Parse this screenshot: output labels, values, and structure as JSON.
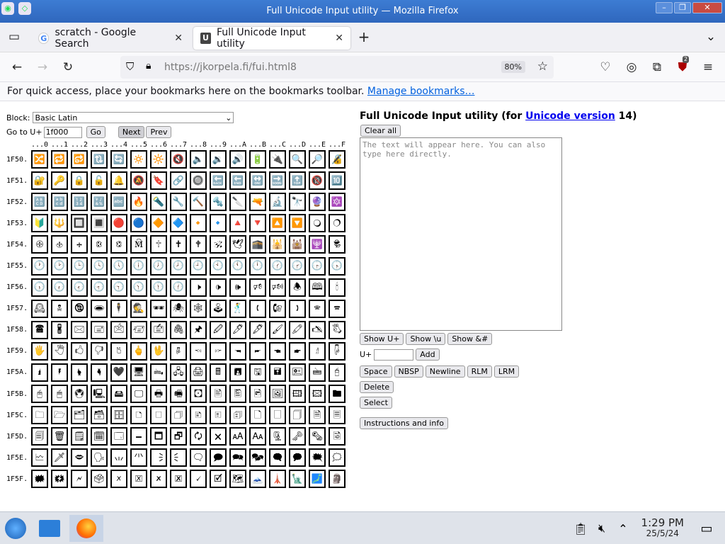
{
  "window": {
    "title": "Full Unicode Input utility — Mozilla Firefox"
  },
  "tabs": [
    {
      "label": "scratch - Google Search"
    },
    {
      "label": "Full Unicode Input utility"
    }
  ],
  "nav": {
    "url_host": "https://jkorpela.fi",
    "url_path": "/fui.html8",
    "zoom": "80%",
    "ext_badge": "2"
  },
  "bookmarks": {
    "text": "For quick access, place your bookmarks here on the bookmarks toolbar.",
    "link": "Manage bookmarks…"
  },
  "page": {
    "block_label": "Block:",
    "block_value": "Basic Latin",
    "goto_label": "Go to U+",
    "goto_value": "1f000",
    "go": "Go",
    "next": "Next",
    "prev": "Prev",
    "title_pre": "Full Unicode Input utility (for ",
    "title_link": "Unicode version",
    "title_post": " 14)",
    "clear_all": "Clear all",
    "placeholder": "The text will appear here. You can also type here directly.",
    "show_u": "Show U+",
    "show_bu": "Show \\u",
    "show_amp": "Show &#",
    "uplus": "U+",
    "add": "Add",
    "space": "Space",
    "nbsp": "NBSP",
    "newline": "Newline",
    "rlm": "RLM",
    "lrm": "LRM",
    "delete": "Delete",
    "select": "Select",
    "instructions": "Instructions and info"
  },
  "grid": {
    "col_headers": [
      "...0",
      "...1",
      "...2",
      "...3",
      "...4",
      "...5",
      "...6",
      "...7",
      "...8",
      "...9",
      "...A",
      "...B",
      "...C",
      "...D",
      "...E",
      "...F"
    ],
    "rows": [
      {
        "label": "1F50.",
        "cells": [
          "🔀",
          "🔁",
          "🔂",
          "🔃",
          "🔄",
          "🔅",
          "🔆",
          "🔇",
          "🔈",
          "🔉",
          "🔊",
          "🔋",
          "🔌",
          "🔍",
          "🔎",
          "🔏"
        ]
      },
      {
        "label": "1F51.",
        "cells": [
          "🔐",
          "🔑",
          "🔒",
          "🔓",
          "🔔",
          "🔕",
          "🔖",
          "🔗",
          "🔘",
          "🔙",
          "🔚",
          "🔛",
          "🔜",
          "🔝",
          "🔞",
          "🔟"
        ]
      },
      {
        "label": "1F52.",
        "cells": [
          "🔠",
          "🔡",
          "🔢",
          "🔣",
          "🔤",
          "🔥",
          "🔦",
          "🔧",
          "🔨",
          "🔩",
          "🔪",
          "🔫",
          "🔬",
          "🔭",
          "🔮",
          "🔯"
        ]
      },
      {
        "label": "1F53.",
        "cells": [
          "🔰",
          "🔱",
          "🔲",
          "🔳",
          "🔴",
          "🔵",
          "🔶",
          "🔷",
          "🔸",
          "🔹",
          "🔺",
          "🔻",
          "🔼",
          "🔽",
          "🔾",
          "🔿"
        ]
      },
      {
        "label": "1F54.",
        "cells": [
          "🕀",
          "🕁",
          "🕂",
          "🕃",
          "🕄",
          "🕅",
          "🕆",
          "🕇",
          "🕈",
          "🕉",
          "🕊",
          "🕋",
          "🕌",
          "🕍",
          "🕎",
          "🕏"
        ]
      },
      {
        "label": "1F55.",
        "cells": [
          "🕐",
          "🕑",
          "🕒",
          "🕓",
          "🕔",
          "🕕",
          "🕖",
          "🕗",
          "🕘",
          "🕙",
          "🕚",
          "🕛",
          "🕜",
          "🕝",
          "🕞",
          "🕟"
        ]
      },
      {
        "label": "1F56.",
        "cells": [
          "🕠",
          "🕡",
          "🕢",
          "🕣",
          "🕤",
          "🕥",
          "🕦",
          "🕧",
          "🕨",
          "🕩",
          "🕪",
          "🕫",
          "🕬",
          "🕭",
          "🕮",
          "🕯"
        ]
      },
      {
        "label": "1F57.",
        "cells": [
          "🕰",
          "🕱",
          "🕲",
          "🕳",
          "🕴",
          "🕵",
          "🕶",
          "🕷",
          "🕸",
          "🕹",
          "🕺",
          "🕻",
          "🕼",
          "🕽",
          "🕾",
          "🕿"
        ]
      },
      {
        "label": "1F58.",
        "cells": [
          "🖀",
          "🖁",
          "🖂",
          "🖃",
          "🖄",
          "🖅",
          "🖆",
          "🖇",
          "🖈",
          "🖉",
          "🖊",
          "🖋",
          "🖌",
          "🖍",
          "🖎",
          "🖏"
        ]
      },
      {
        "label": "1F59.",
        "cells": [
          "🖐",
          "🖑",
          "🖒",
          "🖓",
          "🖔",
          "🖕",
          "🖖",
          "🖗",
          "🖘",
          "🖙",
          "🖚",
          "🖛",
          "🖜",
          "🖝",
          "🖞",
          "🖟"
        ]
      },
      {
        "label": "1F5A.",
        "cells": [
          "🖠",
          "🖡",
          "🖢",
          "🖣",
          "🖤",
          "🖥",
          "🖦",
          "🖧",
          "🖨",
          "🖩",
          "🖪",
          "🖫",
          "🖬",
          "🖭",
          "🖮",
          "🖯"
        ]
      },
      {
        "label": "1F5B.",
        "cells": [
          "🖰",
          "🖱",
          "🖲",
          "🖳",
          "🖴",
          "🖵",
          "🖶",
          "🖷",
          "🖸",
          "🖹",
          "🖺",
          "🖻",
          "🖼",
          "🖽",
          "🖾",
          "🖿"
        ]
      },
      {
        "label": "1F5C.",
        "cells": [
          "🗀",
          "🗁",
          "🗂",
          "🗃",
          "🗄",
          "🗅",
          "🗆",
          "🗇",
          "🗈",
          "🗉",
          "🗊",
          "🗋",
          "🗌",
          "🗍",
          "🗎",
          "🗏"
        ]
      },
      {
        "label": "1F5D.",
        "cells": [
          "🗐",
          "🗑",
          "🗒",
          "🗓",
          "🗔",
          "🗕",
          "🗖",
          "🗗",
          "🗘",
          "🗙",
          "🗚",
          "🗛",
          "🗜",
          "🗝",
          "🗞",
          "🗟"
        ]
      },
      {
        "label": "1F5E.",
        "cells": [
          "🗠",
          "🗡",
          "🗢",
          "🗣",
          "🗤",
          "🗥",
          "🗦",
          "🗧",
          "🗨",
          "🗩",
          "🗪",
          "🗫",
          "🗬",
          "🗭",
          "🗮",
          "🗯"
        ]
      },
      {
        "label": "1F5F.",
        "cells": [
          "🗰",
          "🗱",
          "🗲",
          "🗳",
          "🗴",
          "🗵",
          "🗶",
          "🗷",
          "🗸",
          "🗹",
          "🗺",
          "🗻",
          "🗼",
          "🗽",
          "🗾",
          "🗿"
        ]
      }
    ]
  },
  "taskbar": {
    "time": "1:29 PM",
    "date": "25/5/24"
  }
}
